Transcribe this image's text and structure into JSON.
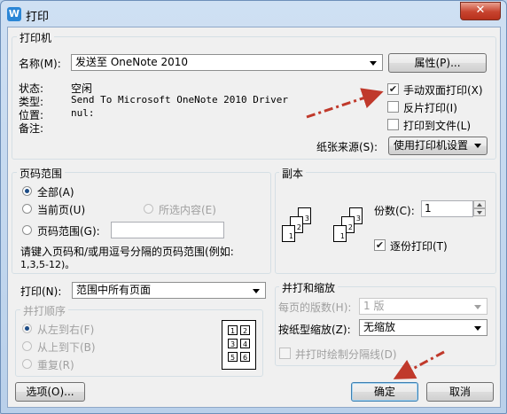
{
  "window": {
    "title": "打印",
    "app_icon_letter": "W",
    "close_glyph": "✕"
  },
  "printer": {
    "group_title": "打印机",
    "name_label": "名称(M):",
    "name_value": "发送至 OneNote 2010",
    "properties_button": "属性(P)...",
    "status_label": "状态:",
    "status_value": "空闲",
    "type_label": "类型:",
    "type_value": "Send To Microsoft OneNote 2010 Driver",
    "location_label": "位置:",
    "location_value": "nul:",
    "comment_label": "备注:",
    "duplex_label": "手动双面打印(X)",
    "duplex_checked": true,
    "reverse_label": "反片打印(I)",
    "reverse_checked": false,
    "to_file_label": "打印到文件(L)",
    "to_file_checked": false,
    "paper_source_label": "纸张来源(S):",
    "paper_source_value": "使用打印机设置"
  },
  "page_range": {
    "group_title": "页码范围",
    "all_label": "全部(A)",
    "current_label": "当前页(U)",
    "selection_label": "所选内容(E)",
    "range_label": "页码范围(G):",
    "range_value": "",
    "hint": "请键入页码和/或用逗号分隔的页码范围(例如:",
    "hint_example": "1,3,5-12)。",
    "selected": "all"
  },
  "copies": {
    "group_title": "副本",
    "count_label": "份数(C):",
    "count_value": "1",
    "collate_label": "逐份打印(T)",
    "collate_checked": true,
    "stack1": [
      "1",
      "2",
      "3"
    ],
    "stack2": [
      "1",
      "2",
      "3"
    ]
  },
  "print_what": {
    "label": "打印(N):",
    "value": "范围中所有页面"
  },
  "print_order": {
    "group_title": "并打顺序",
    "left_right": "从左到右(F)",
    "top_bottom": "从上到下(B)",
    "repeat": "重复(R)",
    "grid": [
      "1",
      "2",
      "3",
      "4",
      "5",
      "6"
    ]
  },
  "zoom": {
    "group_title": "并打和缩放",
    "pages_per_sheet_label": "每页的版数(H):",
    "pages_per_sheet_value": "1 版",
    "scale_label": "按纸型缩放(Z):",
    "scale_value": "无缩放",
    "draw_lines_label": "并打时绘制分隔线(D)"
  },
  "buttons": {
    "options": "选项(O)...",
    "ok": "确定",
    "cancel": "取消"
  },
  "colors": {
    "annotation_arrow": "#c0392b"
  }
}
